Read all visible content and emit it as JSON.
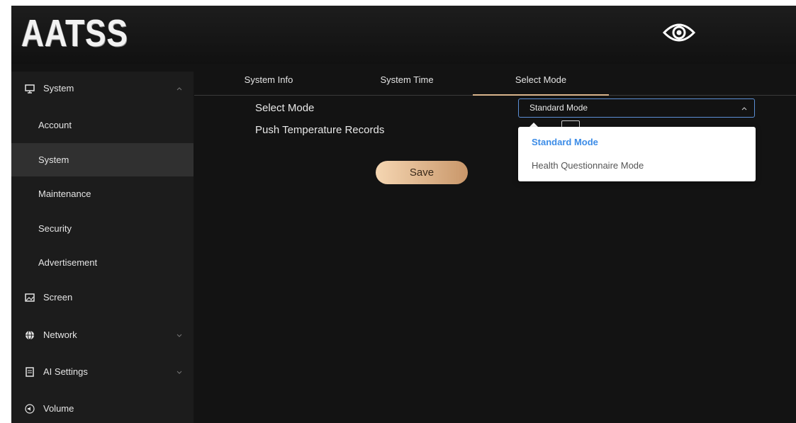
{
  "header": {
    "logo_text": "AATSS",
    "eye_icon": "eye-icon"
  },
  "sidebar": {
    "items": [
      {
        "label": "System",
        "icon": "monitor-icon",
        "type": "group",
        "expanded": true
      },
      {
        "label": "Account",
        "type": "sub"
      },
      {
        "label": "System",
        "type": "sub",
        "active": true
      },
      {
        "label": "Maintenance",
        "type": "sub"
      },
      {
        "label": "Security",
        "type": "sub"
      },
      {
        "label": "Advertisement",
        "type": "sub"
      },
      {
        "label": "Screen",
        "icon": "image-icon",
        "type": "group"
      },
      {
        "label": "Network",
        "icon": "globe-icon",
        "type": "group",
        "expandable": true
      },
      {
        "label": "AI Settings",
        "icon": "clipboard-icon",
        "type": "group",
        "expandable": true
      },
      {
        "label": "Volume",
        "icon": "speaker-icon",
        "type": "group"
      }
    ]
  },
  "tabs": [
    {
      "label": "System Info"
    },
    {
      "label": "System Time"
    },
    {
      "label": "Select Mode",
      "active": true
    }
  ],
  "form": {
    "select_mode_label": "Select Mode",
    "push_records_label": "Push Temperature Records",
    "select_value": "Standard Mode",
    "save_label": "Save"
  },
  "dropdown": {
    "options": [
      {
        "label": "Standard Mode",
        "selected": true
      },
      {
        "label": "Health Questionnaire Mode"
      }
    ]
  },
  "colors": {
    "accent": "#d9b48c",
    "selected_option": "#3c8ce7",
    "select_border": "#5c8fd6",
    "background": "#131313"
  }
}
